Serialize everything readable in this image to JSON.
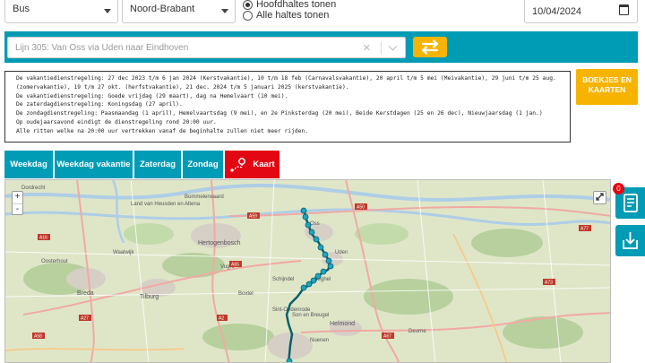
{
  "filters": {
    "transport_type": "Bus",
    "province": "Noord-Brabant",
    "stop_options": [
      {
        "label": "Hoofdhaltes tonen",
        "selected": true
      },
      {
        "label": "Alle haltes tonen",
        "selected": false
      }
    ],
    "date": "10/04/2024"
  },
  "route": {
    "selected": "Lijn 305: Van Oss via Uden naar Eindhoven",
    "clear_icon": "close-icon",
    "swap_icon": "swap-direction-icon"
  },
  "info_lines": [
    "De vakantiedienstregeling: 27 dec 2023 t/m 6 jan 2024 (Kerstvakantie), 10 t/m 18 feb (Carnavalsvakantie), 20 april t/m 5 mei (Meivakantie), 29 juni t/m 25 aug.",
    "(zomervakantie), 19 t/m 27 okt. (herfstvakantie), 21 dec. 2024 t/m 5 januari 2025 (kerstvakantie).",
    "De vakantiedienstregeling: Goede vrijdag (29 maart), dag na Hemelvaart (10 mei).",
    "De zaterdagdienstregeling: Koningsdag (27 april).",
    "De zondagdienstregeling: Paasmaandag (1 april), Hemelvaartsdag (9 mei), en 2e Pinksterdag (20 mei), Beide Kerstdagen (25 en 26 dec), Nieuwjaarsdag (1 jan.)",
    "Op oudejaarsavond eindigt de dienstregeling rond 20:00 uur.",
    "Alle ritten welke na 20:00 uur vertrekken vanaf de beginhalte zullen niet meer rijden."
  ],
  "boekjes_label_1": "BOEKJES EN",
  "boekjes_label_2": "KAARTEN",
  "tabs": [
    {
      "label": "Weekdag",
      "active": false
    },
    {
      "label": "Weekdag vakantie",
      "active": false
    },
    {
      "label": "Zaterdag",
      "active": false
    },
    {
      "label": "Zondag",
      "active": false
    },
    {
      "label": "Kaart",
      "active": true,
      "icon": "route-map-icon"
    }
  ],
  "map": {
    "zoom_in": "+",
    "zoom_out": "-",
    "place_labels": [
      "Dordrecht",
      "Land van Heusden en Altena",
      "Bommelerwaard",
      "Hertogenbosch",
      "Breda",
      "Tilburg",
      "Helmond",
      "Sint-Oedenrode",
      "Son en Breugel",
      "Schijndel",
      "Waalwijk",
      "Oosterhout",
      "Vught",
      "Boxtel",
      "Veghel",
      "Uden",
      "Oss",
      "Nuenen",
      "Deurne"
    ],
    "road_labels": [
      "A16",
      "A27",
      "A59",
      "A2",
      "A50",
      "A58",
      "A65",
      "A67",
      "A73",
      "A77"
    ],
    "route_color": "#0b5f6b",
    "stop_color": "#1aa6c0"
  },
  "side_panel": {
    "badge_count": "0",
    "booklet_icon": "booklet-icon",
    "download_icon": "download-icon"
  }
}
